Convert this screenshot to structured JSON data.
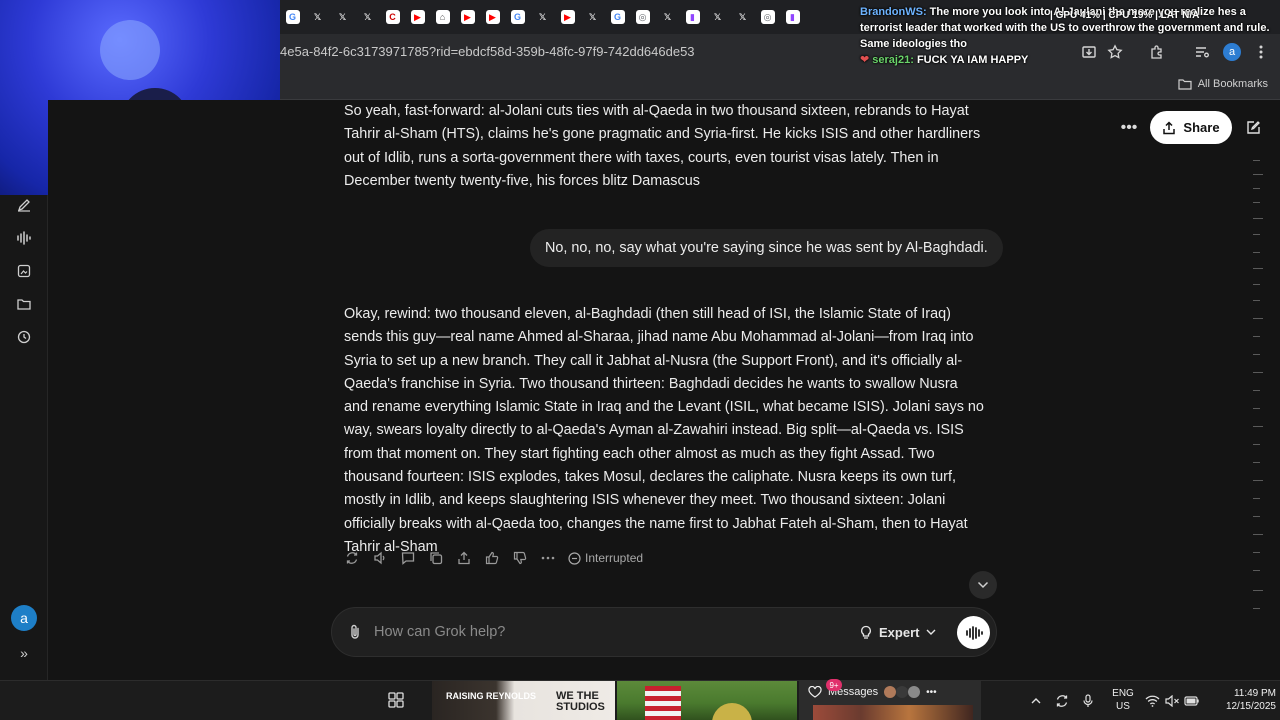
{
  "browser": {
    "url": "4e5a-84f2-6c3173971785?rid=ebdcf58d-359b-48fc-97f9-742dd646de53",
    "all_bookmarks_label": "All Bookmarks",
    "account_initial": "a",
    "tabs": [
      {
        "icon": "google-icon",
        "glyph": "G",
        "color": "#4285f4"
      },
      {
        "icon": "x-icon",
        "glyph": "𝕏",
        "color": "#000000"
      },
      {
        "icon": "x-icon",
        "glyph": "𝕏",
        "color": "#000000"
      },
      {
        "icon": "x-icon",
        "glyph": "𝕏",
        "color": "#000000"
      },
      {
        "icon": "cnn-icon",
        "glyph": "C",
        "color": "#cc0000"
      },
      {
        "icon": "youtube-icon",
        "glyph": "▶",
        "color": "#ff0000"
      },
      {
        "icon": "building-icon",
        "glyph": "⌂",
        "color": "#555555"
      },
      {
        "icon": "youtube-icon",
        "glyph": "▶",
        "color": "#ff0000"
      },
      {
        "icon": "youtube-icon",
        "glyph": "▶",
        "color": "#ff0000"
      },
      {
        "icon": "google-icon",
        "glyph": "G",
        "color": "#4285f4"
      },
      {
        "icon": "x-icon",
        "glyph": "𝕏",
        "color": "#000000"
      },
      {
        "icon": "youtube-icon",
        "glyph": "▶",
        "color": "#ff0000"
      },
      {
        "icon": "x-icon",
        "glyph": "𝕏",
        "color": "#000000"
      },
      {
        "icon": "google-icon",
        "glyph": "G",
        "color": "#4285f4"
      },
      {
        "icon": "chrome-icon",
        "glyph": "◎",
        "color": "#5f6368"
      },
      {
        "icon": "x-icon",
        "glyph": "𝕏",
        "color": "#000000"
      },
      {
        "icon": "twitch-icon",
        "glyph": "▮",
        "color": "#9146ff"
      },
      {
        "icon": "x-icon",
        "glyph": "𝕏",
        "color": "#000000"
      },
      {
        "icon": "x-icon",
        "glyph": "𝕏",
        "color": "#000000"
      },
      {
        "icon": "chrome-icon",
        "glyph": "◎",
        "color": "#5f6368"
      },
      {
        "icon": "twitch-icon",
        "glyph": "▮",
        "color": "#9146ff"
      }
    ]
  },
  "chat_overlay": {
    "msg1_user": "BrandonWS:",
    "msg1_text": "The more you look into Al Jaulani the more you realize hes a terrorist leader that worked with the US to overthrow the government and rule. Same ideologies tho",
    "msg2_user": "seraj21:",
    "msg2_text": "FUCK YA IAM HAPPY",
    "stats": "| GPU 41% | CPU 19% | LAT N/A"
  },
  "grok": {
    "share_label": "Share",
    "assistant_msg_1": "So yeah, fast-forward: al-Jolani cuts ties with al-Qaeda in two thousand sixteen, rebrands to Hayat Tahrir al-Sham (HTS), claims he's gone pragmatic and Syria-first. He kicks ISIS and other hardliners out of Idlib, runs a sorta-government there with taxes, courts, even tourist visas lately. Then in December twenty twenty-five, his forces blitz Damascus",
    "user_msg": "No, no, no, say what you're saying since he was sent by Al-Baghdadi.",
    "assistant_msg_2": "Okay, rewind: two thousand eleven, al-Baghdadi (then still head of ISI, the Islamic State of Iraq) sends this guy—real name Ahmed al-Sharaa, jihad name Abu Mohammad al-Jolani—from Iraq into Syria to set up a new branch. They call it Jabhat al-Nusra (the Support Front), and it's officially al-Qaeda's franchise in Syria. Two thousand thirteen: Baghdadi decides he wants to swallow Nusra and rename everything Islamic State in Iraq and the Levant (ISIL, what became ISIS). Jolani says no way, swears loyalty directly to al-Qaeda's Ayman al-Zawahiri instead. Big split—al-Qaeda vs. ISIS from that moment on. They start fighting each other almost as much as they fight Assad. Two thousand fourteen: ISIS explodes, takes Mosul, declares the caliphate. Nusra keeps its own turf, mostly in Idlib, and keeps slaughtering ISIS whenever they meet. Two thousand sixteen: Jolani officially breaks with al-Qaeda too, changes the name first to Jabhat Fateh al-Sham, then to Hayat Tahrir al-Sham",
    "status": "Interrupted",
    "input_placeholder": "How can Grok help?",
    "mode_label": "Expert",
    "sidebar_avatar": "a"
  },
  "taskbar": {
    "thumb1_left": "RAISING REYNOLDS",
    "thumb1_right": "WE THE STUDIOS",
    "messages_label": "Messages",
    "messages_badge": "9+",
    "lang_line1": "ENG",
    "lang_line2": "US",
    "time": "11:49 PM",
    "date": "12/15/2025"
  },
  "colors": {
    "page_bg": "#141414",
    "bubble_bg": "#232323",
    "accent_avatar": "#1e7fc7",
    "share_bg": "#ffffff"
  }
}
